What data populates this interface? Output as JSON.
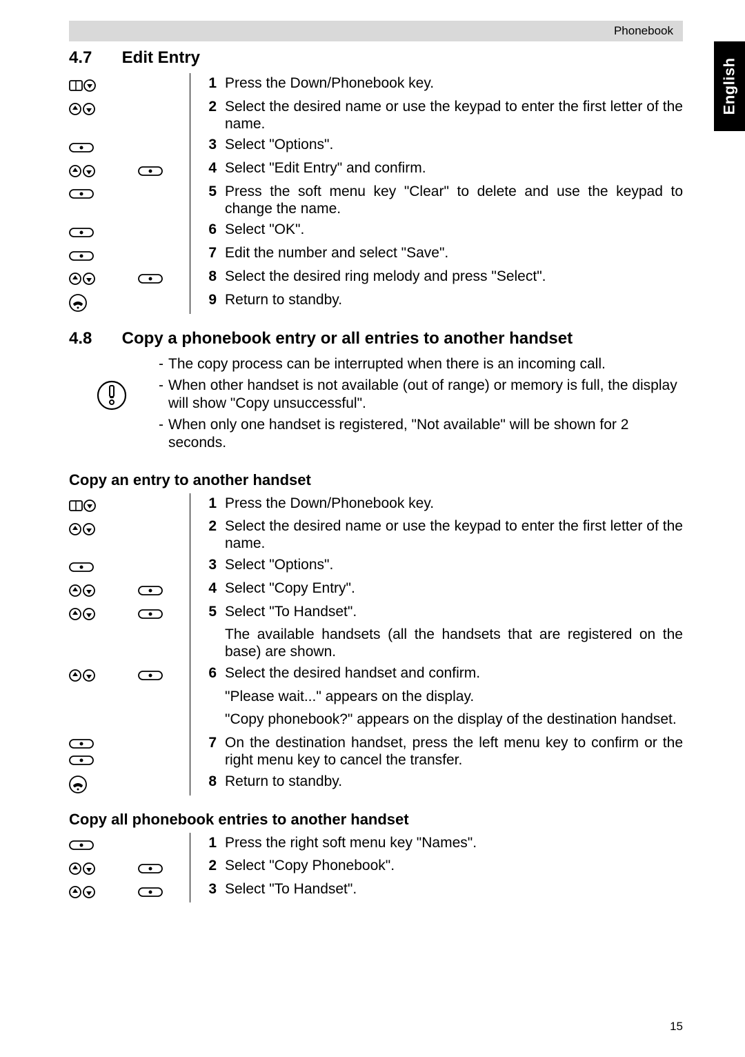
{
  "header": {
    "section": "Phonebook"
  },
  "language_tab": "English",
  "page_number": "15",
  "s47": {
    "number": "4.7",
    "title": "Edit Entry",
    "steps": [
      {
        "n": "1",
        "t": "Press the Down/Phonebook key.",
        "ic1": "book-down",
        "ic2": ""
      },
      {
        "n": "2",
        "t": "Select the desired name or use the keypad to enter the first letter of the name.",
        "ic1": "up-down",
        "ic2": ""
      },
      {
        "n": "3",
        "t": "Select \"Options\".",
        "ic1": "soft",
        "ic2": ""
      },
      {
        "n": "4",
        "t": "Select \"Edit Entry\" and confirm.",
        "ic1": "up-down",
        "ic2": "soft"
      },
      {
        "n": "5",
        "t": "Press the soft menu key \"Clear\" to delete and use the keypad to change the name.",
        "ic1": "soft",
        "ic2": ""
      },
      {
        "n": "6",
        "t": "Select \"OK\".",
        "ic1": "soft",
        "ic2": ""
      },
      {
        "n": "7",
        "t": "Edit the number and select \"Save\".",
        "ic1": "soft",
        "ic2": ""
      },
      {
        "n": "8",
        "t": "Select the desired ring melody and press \"Select\".",
        "ic1": "up-down",
        "ic2": "soft"
      },
      {
        "n": "9",
        "t": "Return to standby.",
        "ic1": "end",
        "ic2": ""
      }
    ]
  },
  "s48": {
    "number": "4.8",
    "title": "Copy a phonebook entry or all entries to another handset",
    "notes": [
      "The copy process can be interrupted when there is an incoming call.",
      "When other handset is not available (out of range) or memory is full, the display will show \"Copy unsuccessful\".",
      "When only one handset is registered, \"Not available\" will be shown for 2 seconds."
    ],
    "sub1_title": "Copy an entry to another handset",
    "sub1_steps": [
      {
        "n": "1",
        "t": "Press the Down/Phonebook key.",
        "ic1": "book-down",
        "ic2": ""
      },
      {
        "n": "2",
        "t": "Select the desired name or use the keypad to enter the first letter of the name.",
        "ic1": "up-down",
        "ic2": ""
      },
      {
        "n": "3",
        "t": "Select \"Options\".",
        "ic1": "soft",
        "ic2": ""
      },
      {
        "n": "4",
        "t": "Select \"Copy Entry\".",
        "ic1": "up-down",
        "ic2": "soft"
      },
      {
        "n": "5",
        "t": "Select \"To Handset\".",
        "ic1": "up-down",
        "ic2": "soft"
      },
      {
        "n": "",
        "t": "The available handsets (all the handsets that are registered on the base) are shown.",
        "ic1": "",
        "ic2": ""
      },
      {
        "n": "6",
        "t": "Select the desired handset and confirm.",
        "ic1": "up-down",
        "ic2": "soft"
      },
      {
        "n": "",
        "t": "\"Please wait...\" appears on the display.",
        "ic1": "",
        "ic2": ""
      },
      {
        "n": "",
        "t": "\"Copy phonebook?\" appears on the display of the destination handset.",
        "ic1": "",
        "ic2": ""
      },
      {
        "n": "7",
        "t": "On the destination handset, press the left menu key to confirm or the right menu key to cancel the transfer.",
        "ic1": "soft-soft",
        "ic2": ""
      },
      {
        "n": "8",
        "t": "Return to standby.",
        "ic1": "end",
        "ic2": ""
      }
    ],
    "sub2_title": "Copy all phonebook entries to another handset",
    "sub2_steps": [
      {
        "n": "1",
        "t": "Press the right soft menu key \"Names\".",
        "ic1": "soft",
        "ic2": ""
      },
      {
        "n": "2",
        "t": "Select \"Copy Phonebook\".",
        "ic1": "up-down",
        "ic2": "soft"
      },
      {
        "n": "3",
        "t": "Select \"To Handset\".",
        "ic1": "up-down",
        "ic2": "soft"
      }
    ]
  }
}
